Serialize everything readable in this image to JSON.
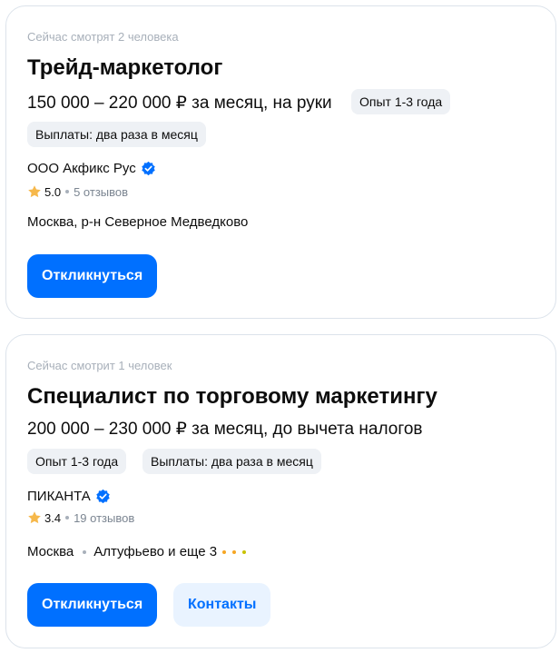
{
  "colors": {
    "accent": "#0070ff",
    "star": "#f6b84b",
    "metro_dots": [
      "#f6a623",
      "#f6a623",
      "#c9c200"
    ]
  },
  "vacancies": [
    {
      "watching": "Сейчас смотрят 2 человека",
      "title": "Трейд-маркетолог",
      "salary": "150 000 – 220 000 ₽ за месяц, на руки",
      "experience": "Опыт 1-3 года",
      "payments": "Выплаты: два раза в месяц",
      "company": "ООО Акфикс Рус",
      "company_verified_icon": "verified-check-icon",
      "rating": "5.0",
      "reviews": "5 отзывов",
      "address": "Москва, р-н Северное Медведково",
      "respond_label": "Откликнуться"
    },
    {
      "watching": "Сейчас смотрит 1 человек",
      "title": "Специалист по торговому маркетингу",
      "salary": "200 000 – 230 000 ₽ за месяц, до вычета налогов",
      "experience": "Опыт 1-3 года",
      "payments": "Выплаты: два раза в месяц",
      "company": "ПИКАНТА",
      "company_verified_icon": "verified-check-icon",
      "rating": "3.4",
      "reviews": "19 отзывов",
      "address_city": "Москва",
      "address_metro": "Алтуфьево и еще 3",
      "respond_label": "Откликнуться",
      "contacts_label": "Контакты"
    }
  ]
}
